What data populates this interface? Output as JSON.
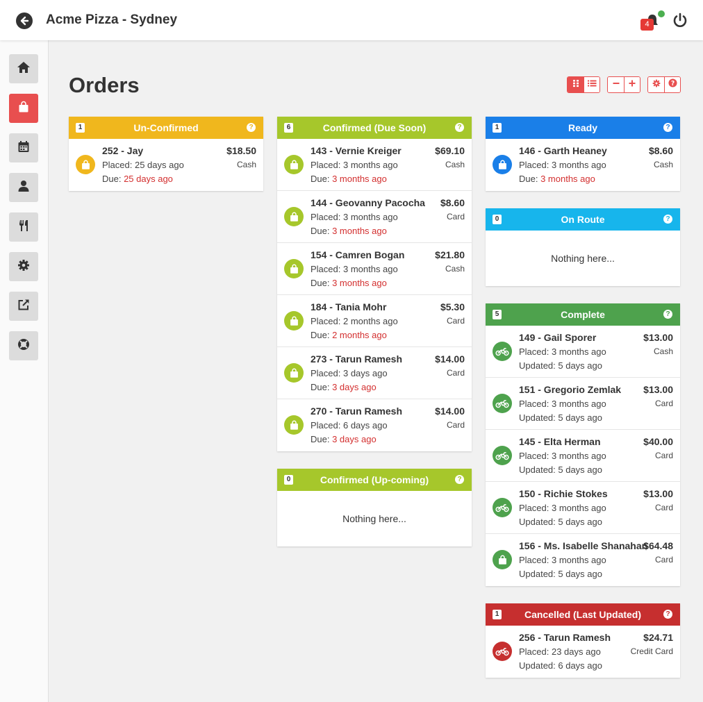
{
  "app": {
    "title": "Acme Pizza - Sydney"
  },
  "header": {
    "notification_count": "4"
  },
  "page": {
    "title": "Orders"
  },
  "colors": {
    "unconfirmed": "#f0b71d",
    "confirmed": "#a6c72b",
    "ready": "#1a7fe8",
    "on_route": "#17b5ec",
    "complete": "#4ea24d",
    "cancelled": "#c62f2f",
    "late_text": "#d32f2f",
    "active_nav": "#e84f4f"
  },
  "sidebar": {
    "items": [
      {
        "icon": "home-icon"
      },
      {
        "icon": "shopping-bag-icon",
        "active": true
      },
      {
        "icon": "calendar-icon"
      },
      {
        "icon": "user-icon"
      },
      {
        "icon": "utensils-icon"
      },
      {
        "icon": "gear-icon"
      },
      {
        "icon": "external-link-icon"
      },
      {
        "icon": "life-ring-icon"
      }
    ]
  },
  "panels": {
    "unconfirmed": {
      "title": "Un-Confirmed",
      "count": "1",
      "help": "?",
      "orders": [
        {
          "name": "252 - Jay",
          "price": "$18.50",
          "payment": "Cash",
          "placed": "Placed: 25 days ago",
          "due_label": "Due: ",
          "due": "25 days ago"
        }
      ]
    },
    "confirmed_due_soon": {
      "title": "Confirmed (Due Soon)",
      "count": "6",
      "help": "?",
      "orders": [
        {
          "name": "143 - Vernie Kreiger",
          "price": "$69.10",
          "payment": "Cash",
          "placed": "Placed: 3 months ago",
          "due_label": "Due: ",
          "due": "3 months ago"
        },
        {
          "name": "144 - Geovanny Pacocha",
          "price": "$8.60",
          "payment": "Card",
          "placed": "Placed: 3 months ago",
          "due_label": "Due: ",
          "due": "3 months ago"
        },
        {
          "name": "154 - Camren Bogan",
          "price": "$21.80",
          "payment": "Cash",
          "placed": "Placed: 3 months ago",
          "due_label": "Due: ",
          "due": "3 months ago"
        },
        {
          "name": "184 - Tania Mohr",
          "price": "$5.30",
          "payment": "Card",
          "placed": "Placed: 2 months ago",
          "due_label": "Due: ",
          "due": "2 months ago"
        },
        {
          "name": "273 - Tarun Ramesh",
          "price": "$14.00",
          "payment": "Card",
          "placed": "Placed: 3 days ago",
          "due_label": "Due: ",
          "due": "3 days ago"
        },
        {
          "name": "270 - Tarun Ramesh",
          "price": "$14.00",
          "payment": "Card",
          "placed": "Placed: 6 days ago",
          "due_label": "Due: ",
          "due": "3 days ago"
        }
      ]
    },
    "confirmed_upcoming": {
      "title": "Confirmed (Up-coming)",
      "count": "0",
      "help": "?",
      "empty": "Nothing here..."
    },
    "ready": {
      "title": "Ready",
      "count": "1",
      "help": "?",
      "orders": [
        {
          "name": "146 - Garth Heaney",
          "price": "$8.60",
          "payment": "Cash",
          "placed": "Placed: 3 months ago",
          "due_label": "Due: ",
          "due": "3 months ago"
        }
      ]
    },
    "on_route": {
      "title": "On Route",
      "count": "0",
      "help": "?",
      "empty": "Nothing here..."
    },
    "complete": {
      "title": "Complete",
      "count": "5",
      "help": "?",
      "orders": [
        {
          "name": "149 - Gail Sporer",
          "price": "$13.00",
          "payment": "Cash",
          "placed": "Placed: 3 months ago",
          "updated": "Updated: 5 days ago",
          "icon": "motorcycle-icon"
        },
        {
          "name": "151 - Gregorio Zemlak",
          "price": "$13.00",
          "payment": "Card",
          "placed": "Placed: 3 months ago",
          "updated": "Updated: 5 days ago",
          "icon": "motorcycle-icon"
        },
        {
          "name": "145 - Elta Herman",
          "price": "$40.00",
          "payment": "Card",
          "placed": "Placed: 3 months ago",
          "updated": "Updated: 5 days ago",
          "icon": "motorcycle-icon"
        },
        {
          "name": "150 - Richie Stokes",
          "price": "$13.00",
          "payment": "Card",
          "placed": "Placed: 3 months ago",
          "updated": "Updated: 5 days ago",
          "icon": "motorcycle-icon"
        },
        {
          "name": "156 - Ms. Isabelle Shanahan",
          "price": "$64.48",
          "payment": "Card",
          "placed": "Placed: 3 months ago",
          "updated": "Updated: 5 days ago",
          "icon": "shopping-bag-icon"
        }
      ]
    },
    "cancelled": {
      "title": "Cancelled (Last Updated)",
      "count": "1",
      "help": "?",
      "orders": [
        {
          "name": "256 - Tarun Ramesh",
          "price": "$24.71",
          "payment": "Credit Card",
          "placed": "Placed: 23 days ago",
          "updated": "Updated: 6 days ago",
          "icon": "motorcycle-icon"
        }
      ]
    }
  }
}
